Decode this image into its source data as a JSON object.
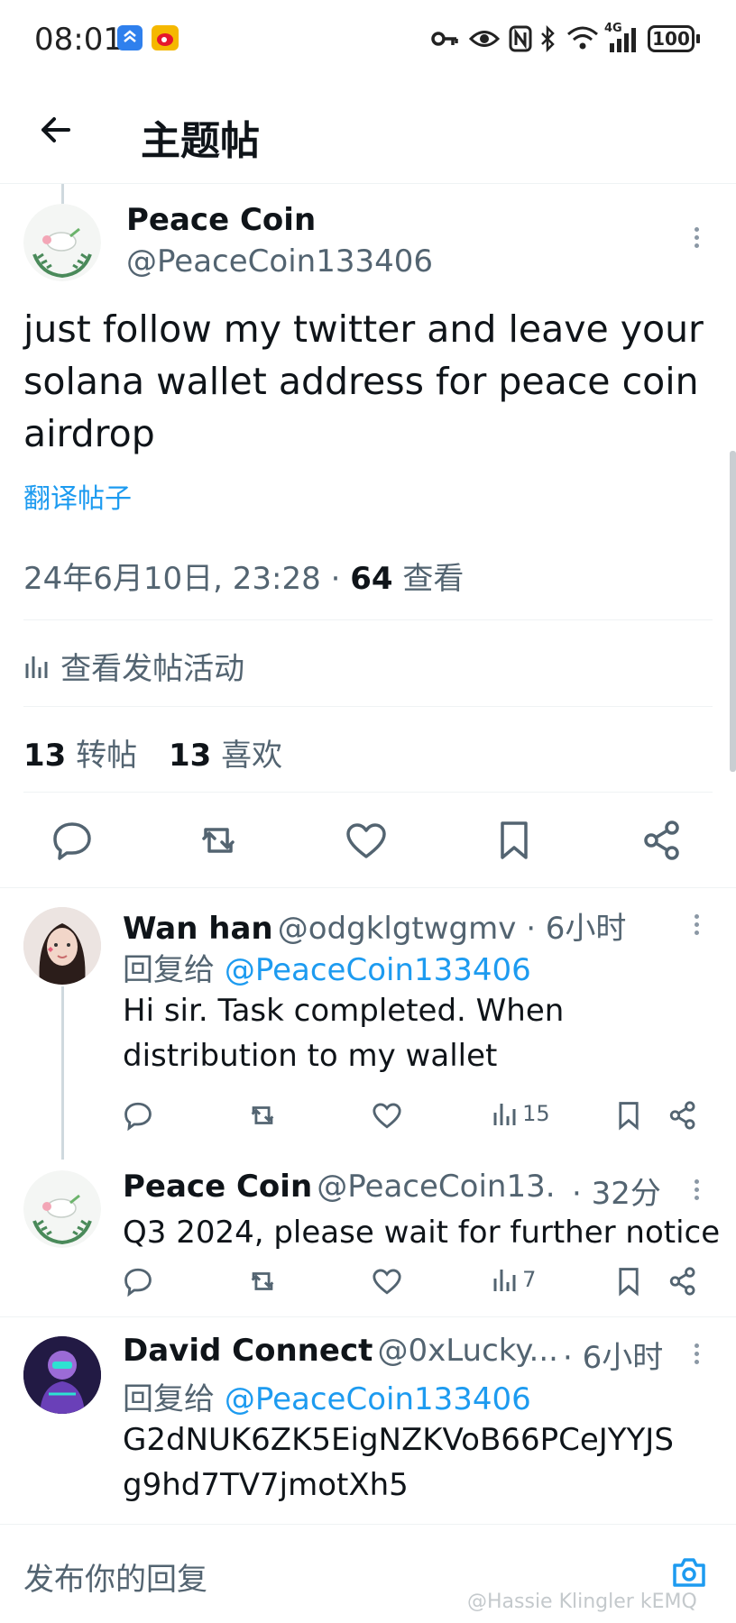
{
  "status_bar": {
    "time": "08:01",
    "battery": "100",
    "network": "4G"
  },
  "header": {
    "title": "主题帖"
  },
  "post": {
    "display_name": "Peace Coin",
    "handle": "@PeaceCoin133406",
    "text": "just follow my twitter and leave your solana wallet address for peace coin airdrop",
    "translate": "翻译帖子",
    "timestamp": "24年6月10日, 23:28 · ",
    "views": "64",
    "views_label": " 查看",
    "activity": "查看发帖活动",
    "reposts": "13",
    "reposts_label": "转帖",
    "likes": "13",
    "likes_label": "喜欢"
  },
  "replies": [
    {
      "display_name": "Wan han",
      "handle_time": "@odgklgtwgmv · 6小时",
      "reply_to_label": "回复给",
      "reply_to": "@PeaceCoin133406",
      "text_line1": "Hi sir. Task completed. When",
      "text_line2": "distribution to my wallet",
      "views": "15"
    },
    {
      "display_name": "Peace Coin",
      "handle_time": "@PeaceCoin13...",
      "time": "· 32分",
      "text_line1": "Q3 2024, please wait for further notice",
      "views": "7"
    },
    {
      "display_name": "David Connect",
      "handle_time": "@0xLucky...",
      "time": "· 6小时",
      "reply_to_label": "回复给",
      "reply_to": "@PeaceCoin133406",
      "text_line1": "G2dNUK6ZK5EigNZKVoB66PCeJYYJS",
      "text_line2": "g9hd7TV7jmotXh5"
    }
  ],
  "composer": {
    "placeholder": "发布你的回复"
  },
  "watermark": "@Hassie Klingler kEMQ",
  "colors": {
    "accent": "#1d9bf0",
    "muted": "#536471",
    "text": "#0f1419"
  }
}
